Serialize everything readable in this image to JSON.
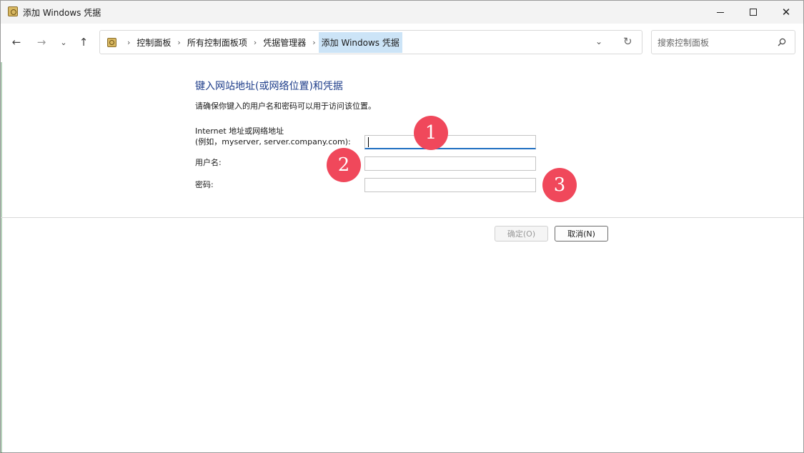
{
  "window": {
    "title": "添加 Windows 凭据",
    "minimize_label": "—",
    "maximize_label": "☐",
    "close_label": "✕"
  },
  "nav": {
    "back": "←",
    "forward": "→",
    "history": "⌄",
    "up": "↑"
  },
  "breadcrumb": {
    "items": [
      "控制面板",
      "所有控制面板项",
      "凭据管理器",
      "添加 Windows 凭据"
    ],
    "separator": "›",
    "dropdown": "⌄",
    "refresh": "↻"
  },
  "search": {
    "placeholder": "搜索控制面板"
  },
  "content": {
    "heading": "键入网站地址(或网络位置)和凭据",
    "subtext": "请确保你键入的用户名和密码可以用于访问该位置。",
    "address_label_line1": "Internet 地址或网络地址",
    "address_label_line2": "(例如，myserver, server.company.com):",
    "username_label": "用户名:",
    "password_label": "密码:",
    "address_value": "",
    "username_value": "",
    "password_value": ""
  },
  "markers": [
    "1",
    "2",
    "3"
  ],
  "buttons": {
    "ok": "确定(O)",
    "cancel": "取消(N)"
  },
  "icons": {
    "title": "credential-manager-icon",
    "search": "search-icon",
    "refresh": "refresh-icon"
  },
  "colors": {
    "heading": "#1e3d8a",
    "marker": "#f0485b",
    "focus": "#1f6fc1",
    "active_crumb": "#cce4f7"
  }
}
